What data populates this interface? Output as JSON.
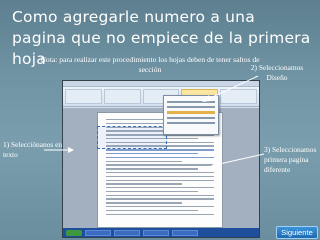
{
  "slide": {
    "title": "Como agregarle numero a una pagina que no empiece de la primera hoja",
    "note": "Nota: para realizar este procedimiento los hojas deben de tener saltos de sección"
  },
  "callouts": {
    "step1": "1) Selecciónanos en texto",
    "step2": "2) Seleccionamos Diseño",
    "step3": "3) Seleccionamos primera pagina diferente"
  },
  "navigation": {
    "next_label": "Siguiente"
  },
  "colors": {
    "background": "#6f93a3",
    "text": "#ffffff",
    "button": "#1e6bb0"
  }
}
